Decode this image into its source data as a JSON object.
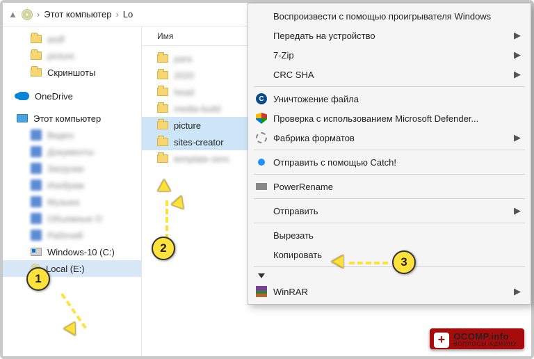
{
  "breadcrumb": {
    "item1": "Этот компьютер",
    "item2": "Lo"
  },
  "nav": {
    "blur1": "asdf",
    "blur2": "picture",
    "screenshots": "Скриншоты",
    "onedrive": "OneDrive",
    "thispc": "Этот компьютер",
    "sub_blur1": "Видео",
    "sub_blur2": "Документы",
    "sub_blur3": "Загрузки",
    "sub_blur4": "Изображ",
    "sub_blur5": "Музыка",
    "sub_blur6": "Объемные O",
    "sub_blur7": "Рабочий",
    "windrive": "Windows-10 (С:)",
    "localdrive": "Local (E:)"
  },
  "column": {
    "name": "Имя"
  },
  "files": {
    "b1": "para",
    "b2": "2020",
    "b3": "head",
    "b4": "media-build",
    "picture": "picture",
    "sites": "sites-creator",
    "b5": "template-zero"
  },
  "ctx": {
    "play": "Воспроизвести с помощью проигрывателя Windows",
    "cast": "Передать на устройство",
    "zip": "7-Zip",
    "crc": "CRC SHA",
    "shred": "Уничтожение файла",
    "defender": "Проверка с использованием Microsoft Defender...",
    "factory": "Фабрика форматов",
    "catch": "Отправить с помощью Catch!",
    "powerrename": "PowerRename",
    "send": "Отправить",
    "cut": "Вырезать",
    "copy": "Копировать",
    "winrar": "WinRAR"
  },
  "badges": {
    "b1": "1",
    "b2": "2",
    "b3": "3"
  },
  "watermark": {
    "main": "OCOMP.info",
    "sub": "ВОПРОСЫ АДМИНУ"
  }
}
